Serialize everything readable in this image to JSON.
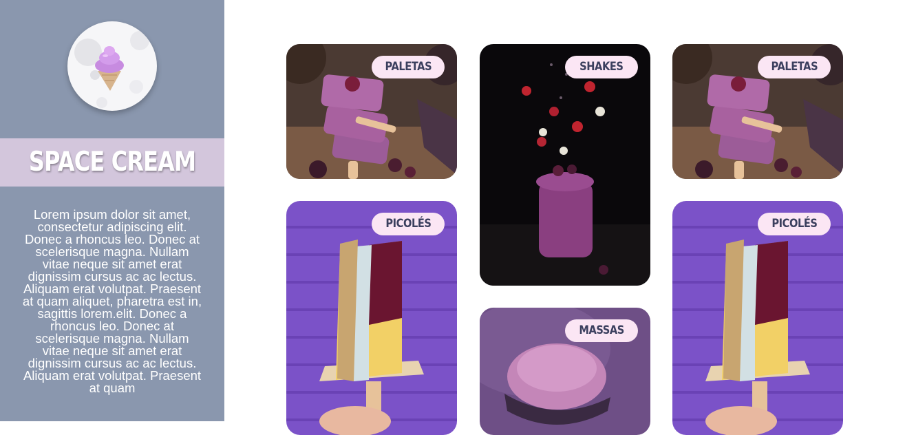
{
  "brand": {
    "title": "SPACE CREAM",
    "logo_icon": "ice-cream-cone-icon"
  },
  "about": {
    "text": "Lorem ipsum dolor sit amet, consectetur adipiscing elit. Donec a rhoncus leo. Donec at scelerisque magna. Nullam vitae neque sit amet erat dignissim cursus ac ac lectus. Aliquam erat volutpat. Praesent at quam aliquet, pharetra est in, sagittis lorem.elit. Donec a rhoncus leo. Donec at scelerisque magna. Nullam vitae neque sit amet erat dignissim cursus ac ac lectus. Aliquam erat volutpat. Praesent at quam"
  },
  "gallery": {
    "cards": [
      {
        "label": "PALETAS",
        "image": "berry-ice-cream-bars-photo"
      },
      {
        "label": "SHAKES",
        "image": "berry-shake-jar-photo"
      },
      {
        "label": "PALETAS",
        "image": "berry-ice-cream-bars-photo"
      },
      {
        "label": "PICOLÉS",
        "image": "popsicle-purple-wall-photo"
      },
      {
        "label": "MASSAS",
        "image": "ice-cream-scoop-photo"
      },
      {
        "label": "PICOLÉS",
        "image": "popsicle-purple-wall-photo"
      }
    ]
  },
  "colors": {
    "sidebar": "#8a97ae",
    "brand_band": "#d3c6dc",
    "tag_background": "#fbe6f4",
    "tag_text": "#3b3f5e"
  }
}
